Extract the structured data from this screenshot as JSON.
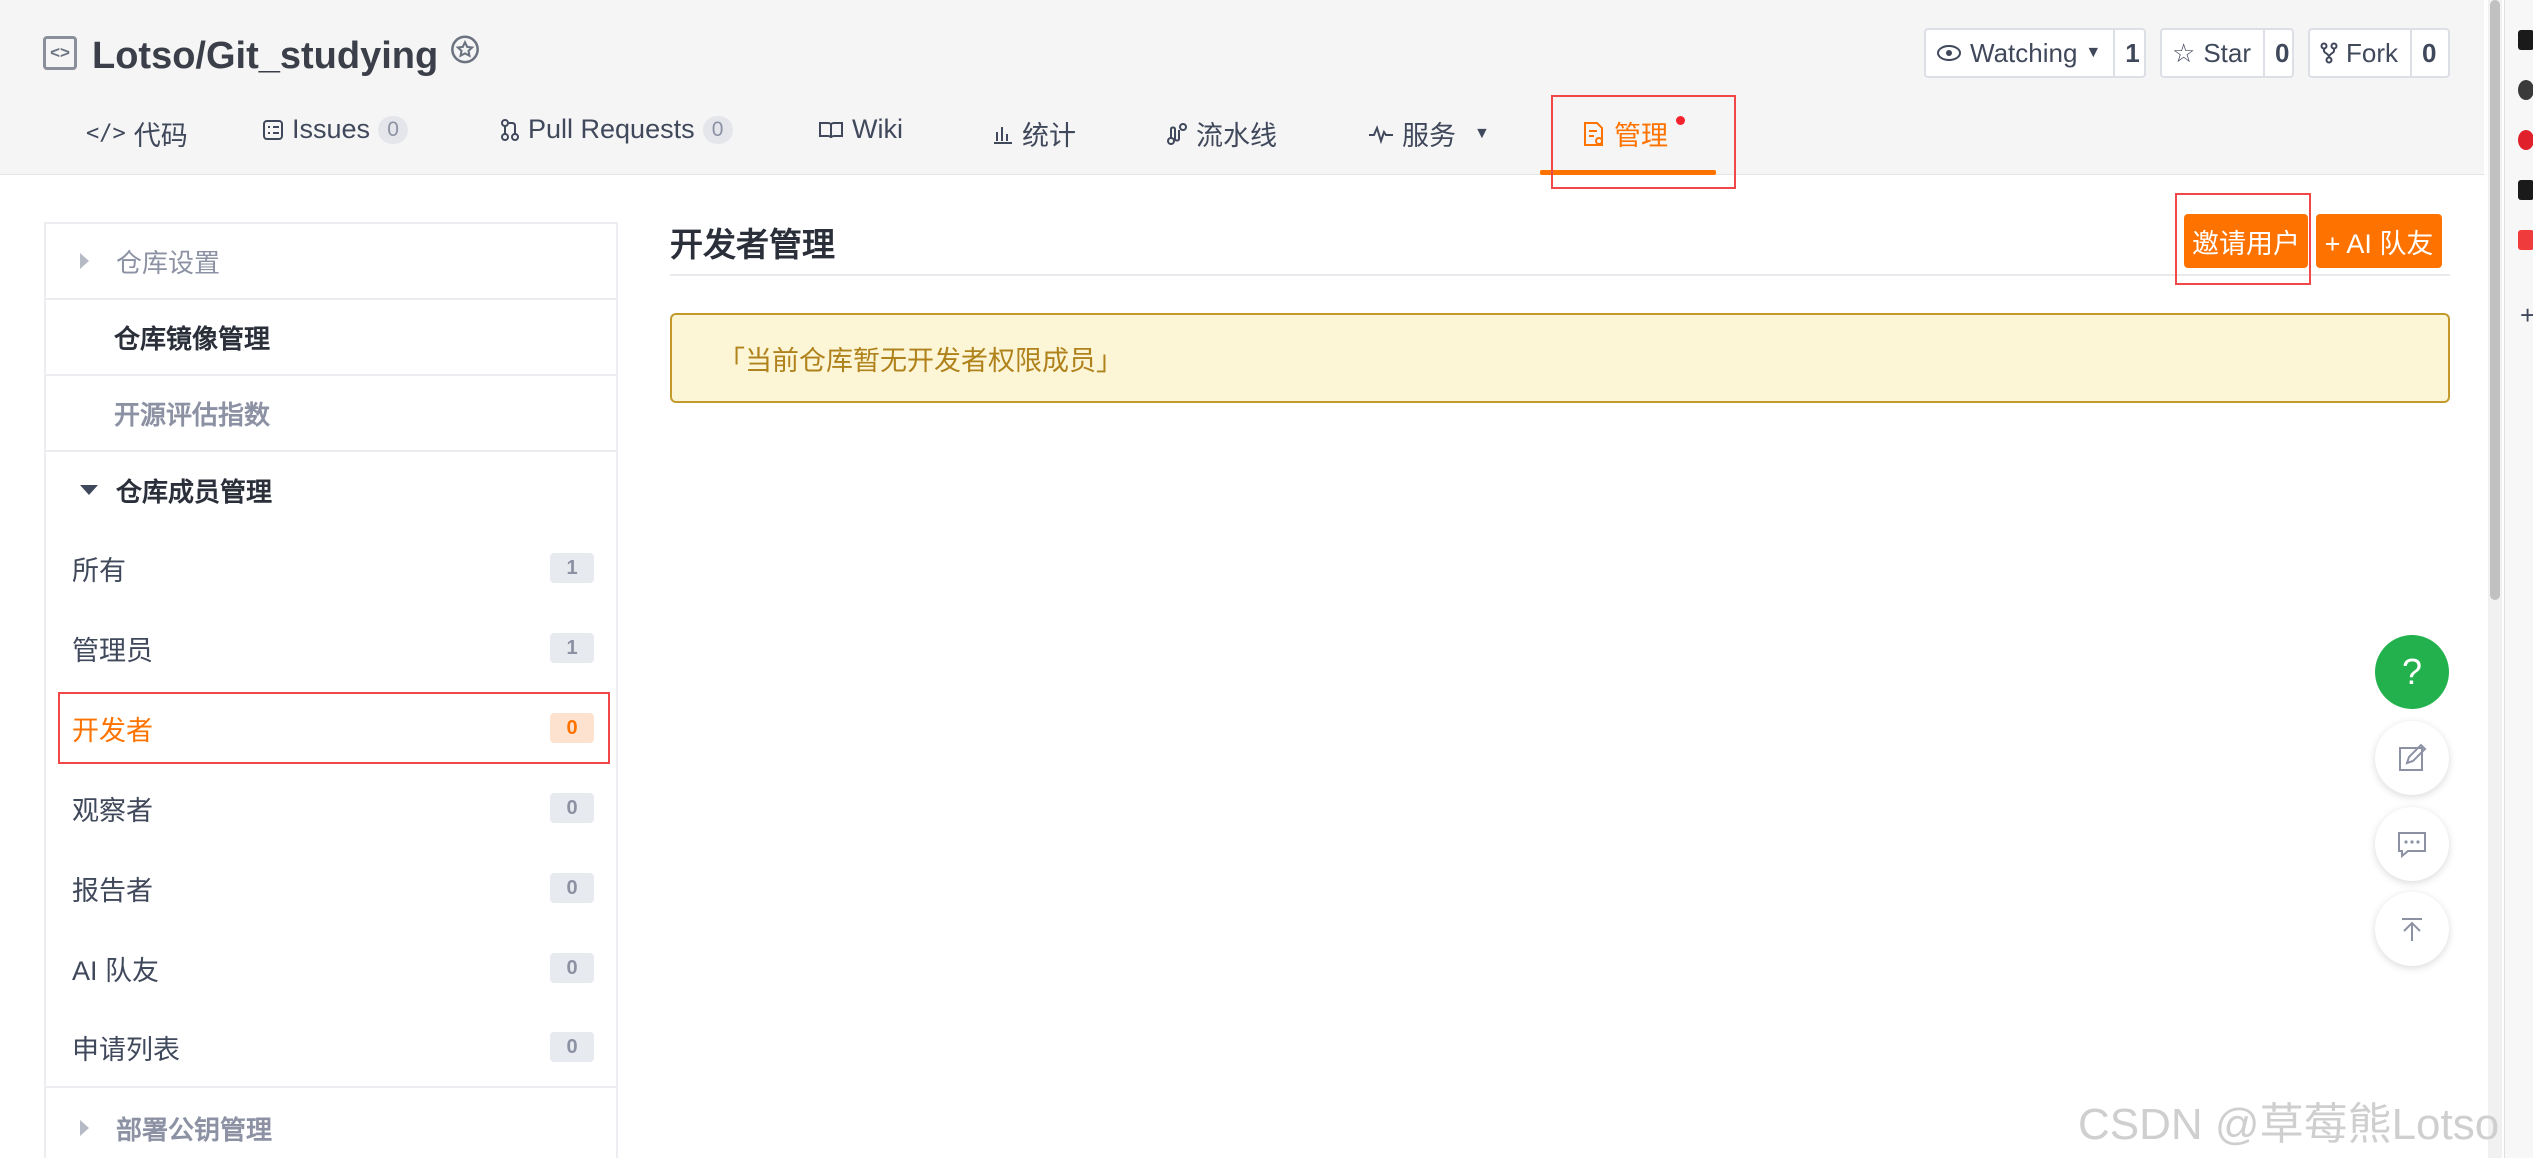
{
  "header": {
    "repo_icon": "code-brackets-icon",
    "repo_title": "Lotso/Git_studying",
    "badge_icon": "award-badge-icon",
    "watching": {
      "label": "Watching",
      "count": "1"
    },
    "star": {
      "label": "Star",
      "count": "0"
    },
    "fork": {
      "label": "Fork",
      "count": "0"
    }
  },
  "tabs": [
    {
      "label": "代码",
      "icon": "code-icon"
    },
    {
      "label": "Issues",
      "icon": "issues-icon",
      "count": "0"
    },
    {
      "label": "Pull Requests",
      "icon": "pull-request-icon",
      "count": "0"
    },
    {
      "label": "Wiki",
      "icon": "book-icon"
    },
    {
      "label": "统计",
      "icon": "bar-chart-icon"
    },
    {
      "label": "流水线",
      "icon": "pipeline-icon"
    },
    {
      "label": "服务",
      "icon": "pulse-icon"
    },
    {
      "label": "管理",
      "icon": "manage-doc-icon",
      "active": true
    }
  ],
  "sidebar": {
    "groups": [
      {
        "label": "仓库设置",
        "expanded": false
      },
      {
        "label": "仓库镜像管理"
      },
      {
        "label": "开源评估指数"
      },
      {
        "label": "仓库成员管理",
        "expanded": true
      }
    ],
    "items": [
      {
        "label": "所有",
        "count": "1"
      },
      {
        "label": "管理员",
        "count": "1"
      },
      {
        "label": "开发者",
        "count": "0",
        "active": true
      },
      {
        "label": "观察者",
        "count": "0"
      },
      {
        "label": "报告者",
        "count": "0"
      },
      {
        "label": "AI 队友",
        "count": "0"
      },
      {
        "label": "申请列表",
        "count": "0"
      }
    ],
    "bottom_group": {
      "label": "部署公钥管理",
      "expanded": false
    }
  },
  "main": {
    "title": "开发者管理",
    "invite_button": "邀请用户",
    "ai_button": "+ AI 队友",
    "notice": "「当前仓库暂无开发者权限成员」"
  },
  "floating": {
    "help": "?",
    "feedback_icon": "edit-feedback-icon",
    "chat_icon": "chat-icon",
    "top_icon": "back-to-top-icon"
  },
  "watermark": "CSDN @草莓熊Lotso",
  "colors": {
    "accent": "#fe7300",
    "highlight_box": "#f04848",
    "notice_bg": "#fdf6d6",
    "notice_text": "#b0821c",
    "help_green": "#22b14c"
  }
}
